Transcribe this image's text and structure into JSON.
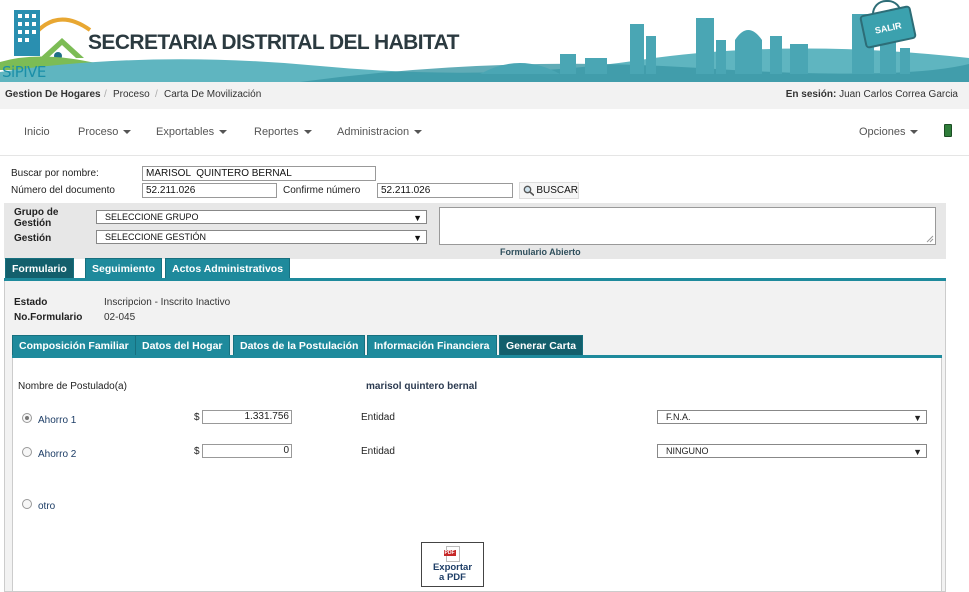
{
  "header": {
    "title": "SECRETARIA DISTRITAL DEL HABITAT",
    "logo_text": "SiPIVE",
    "exit_label": "SALIR"
  },
  "breadcrumb": {
    "items": [
      "Gestion De Hogares",
      "Proceso",
      "Carta De Movilización"
    ],
    "separator": "/",
    "session_label": "En sesión:",
    "session_user": "Juan Carlos Correa Garcia"
  },
  "nav": {
    "items": [
      "Inicio",
      "Proceso",
      "Exportables",
      "Reportes",
      "Administracion"
    ],
    "options": "Opciones"
  },
  "search": {
    "name_label": "Buscar por nombre:",
    "name_value": "MARISOL  QUINTERO BERNAL",
    "doc_label": "Número del documento",
    "doc_value": "52.211.026",
    "confirm_label": "Confirme número",
    "confirm_value": "52.211.026",
    "button_label": "BUSCAR"
  },
  "gestion": {
    "grupo_label_1": "Grupo de",
    "grupo_label_2": "Gestión",
    "grupo_value": "SELECCIONE GRUPO",
    "gestion_label": "Gestión",
    "gestion_value": "SELECCIONE GESTIÓN",
    "form_status": "Formulario Abierto"
  },
  "main_tabs": [
    "Formulario",
    "Seguimiento",
    "Actos Administrativos"
  ],
  "form_info": {
    "estado_label": "Estado",
    "estado_value": "Inscripcion - Inscrito Inactivo",
    "numero_label": "No.Formulario",
    "numero_value": "02-045"
  },
  "sub_tabs": [
    "Composición Familiar",
    "Datos del Hogar",
    "Datos de la Postulación",
    "Información Financiera",
    "Generar Carta"
  ],
  "carta": {
    "postulado_label": "Nombre de Postulado(a)",
    "postulado_value": "marisol quintero bernal",
    "currency": "$",
    "entity_label": "Entidad",
    "rows": [
      {
        "label": "Ahorro 1",
        "amount": "1.331.756",
        "entity": "F.N.A."
      },
      {
        "label": "Ahorro 2",
        "amount": "0",
        "entity": "NINGUNO"
      }
    ],
    "other_label": "otro",
    "export_label_1": "Exportar",
    "export_label_2": "a PDF"
  },
  "colors": {
    "accent": "#1e8a9c",
    "accent_dark": "#135f6c",
    "panel_grey": "#e7e7e7"
  }
}
